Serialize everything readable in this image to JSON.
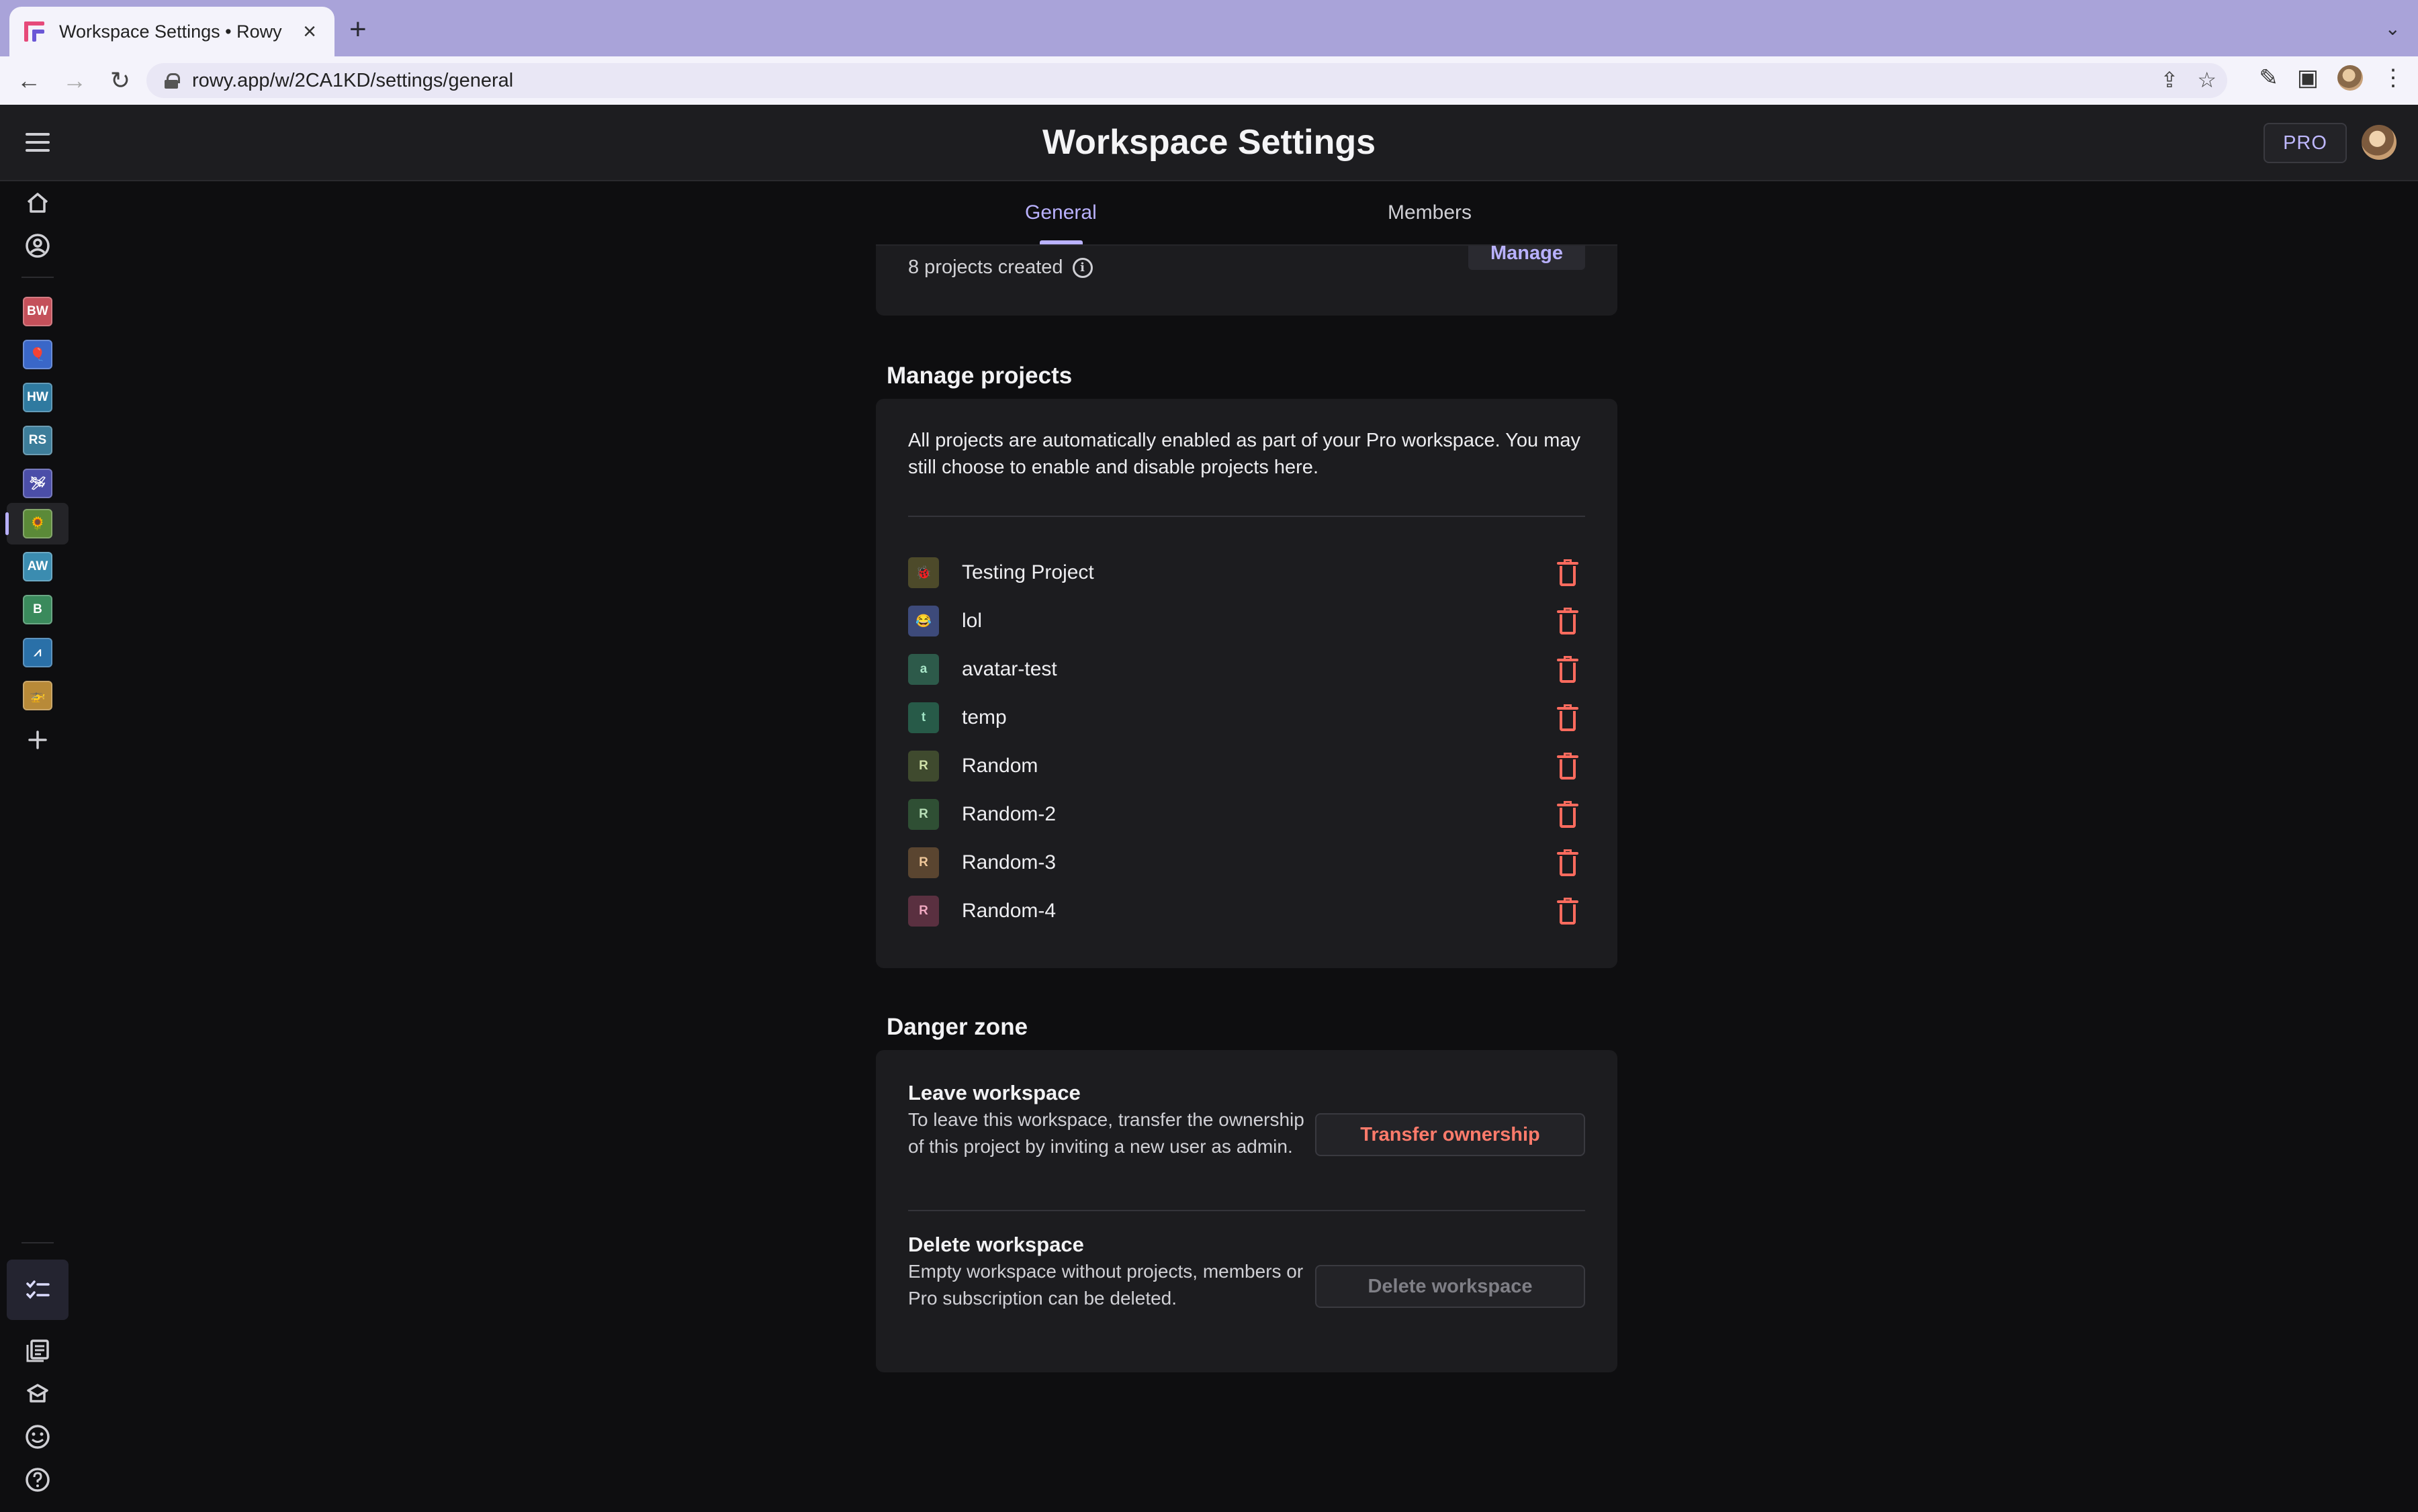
{
  "browser": {
    "tab_title": "Workspace Settings • Rowy",
    "url": "rowy.app/w/2CA1KD/settings/general"
  },
  "app": {
    "title": "Workspace Settings",
    "pro_badge": "PRO"
  },
  "sidebar": {
    "projects": [
      {
        "label": "BW",
        "bg": "#c4505a"
      },
      {
        "label": "🎈",
        "bg": "#3a67c8"
      },
      {
        "label": "HW",
        "bg": "#2f7aa0"
      },
      {
        "label": "RS",
        "bg": "#3d7d9a"
      },
      {
        "label": "🛩",
        "bg": "#4b4ea8"
      },
      {
        "label": "🌻",
        "bg": "#5b8a38"
      },
      {
        "label": "AW",
        "bg": "#3b8cb0"
      },
      {
        "label": "B",
        "bg": "#3a8a5c"
      },
      {
        "label": "⩘",
        "bg": "#2a70a8"
      },
      {
        "label": "🚁",
        "bg": "#b88a38"
      }
    ]
  },
  "tabs": {
    "general": "General",
    "members": "Members"
  },
  "usage": {
    "projects_created": "8 projects created",
    "manage_label": "Manage"
  },
  "manage_projects": {
    "title": "Manage projects",
    "description": "All projects are automatically enabled as part of your Pro workspace. You may still choose to enable and disable projects here.",
    "items": [
      {
        "name": "Testing Project",
        "avatar": "🐞",
        "bg": "#4d4a2a",
        "fg": "#f0d060"
      },
      {
        "name": "lol",
        "avatar": "😂",
        "bg": "#3d4a7a",
        "fg": "#ffd34d"
      },
      {
        "name": "avatar-test",
        "avatar": "a",
        "bg": "#2d5a4a",
        "fg": "#a8e6c8"
      },
      {
        "name": "temp",
        "avatar": "t",
        "bg": "#275a48",
        "fg": "#9fe3c4"
      },
      {
        "name": "Random",
        "avatar": "R",
        "bg": "#3f4a2e",
        "fg": "#cfe0a8"
      },
      {
        "name": "Random-2",
        "avatar": "R",
        "bg": "#2f4f34",
        "fg": "#b8e0b8"
      },
      {
        "name": "Random-3",
        "avatar": "R",
        "bg": "#5a4530",
        "fg": "#f0c89a"
      },
      {
        "name": "Random-4",
        "avatar": "R",
        "bg": "#5a3040",
        "fg": "#f0a8c0"
      }
    ]
  },
  "danger_zone": {
    "title": "Danger zone",
    "leave": {
      "title": "Leave workspace",
      "description": "To leave this workspace, transfer the ownership of this project by inviting a new user as admin.",
      "button": "Transfer ownership"
    },
    "delete": {
      "title": "Delete workspace",
      "description": "Empty workspace without projects, members or Pro subscription can be deleted.",
      "button": "Delete workspace"
    }
  }
}
